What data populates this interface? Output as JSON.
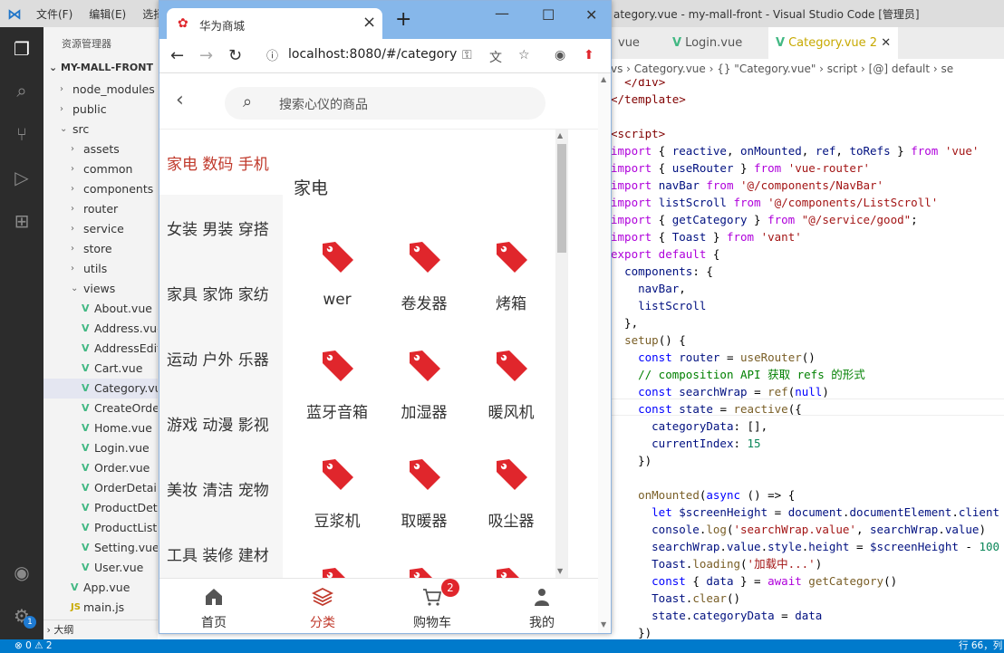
{
  "vscode": {
    "menu": [
      "文件(F)",
      "编辑(E)",
      "选择"
    ],
    "window_title": "ategory.vue - my-mall-front - Visual Studio Code [管理员]",
    "explorer_title": "资源管理器",
    "project_root": "MY-MALL-FRONT",
    "tree": [
      {
        "label": "node_modules",
        "type": "folder",
        "indent": 1
      },
      {
        "label": "public",
        "type": "folder",
        "indent": 1
      },
      {
        "label": "src",
        "type": "folder-open",
        "indent": 1
      },
      {
        "label": "assets",
        "type": "folder",
        "indent": 2
      },
      {
        "label": "common",
        "type": "folder",
        "indent": 2
      },
      {
        "label": "components",
        "type": "folder",
        "indent": 2
      },
      {
        "label": "router",
        "type": "folder",
        "indent": 2
      },
      {
        "label": "service",
        "type": "folder",
        "indent": 2
      },
      {
        "label": "store",
        "type": "folder",
        "indent": 2
      },
      {
        "label": "utils",
        "type": "folder",
        "indent": 2
      },
      {
        "label": "views",
        "type": "folder-open",
        "indent": 2
      },
      {
        "label": "About.vue",
        "type": "vue",
        "indent": 3
      },
      {
        "label": "Address.vue",
        "type": "vue",
        "indent": 3
      },
      {
        "label": "AddressEdit.vue",
        "type": "vue",
        "indent": 3
      },
      {
        "label": "Cart.vue",
        "type": "vue",
        "indent": 3
      },
      {
        "label": "Category.vue",
        "type": "vue",
        "indent": 3,
        "selected": true
      },
      {
        "label": "CreateOrder.vue",
        "type": "vue",
        "indent": 3
      },
      {
        "label": "Home.vue",
        "type": "vue",
        "indent": 3
      },
      {
        "label": "Login.vue",
        "type": "vue",
        "indent": 3
      },
      {
        "label": "Order.vue",
        "type": "vue",
        "indent": 3
      },
      {
        "label": "OrderDetail.vue",
        "type": "vue",
        "indent": 3
      },
      {
        "label": "ProductDetail.vue",
        "type": "vue",
        "indent": 3
      },
      {
        "label": "ProductList.vue",
        "type": "vue",
        "indent": 3
      },
      {
        "label": "Setting.vue",
        "type": "vue",
        "indent": 3
      },
      {
        "label": "User.vue",
        "type": "vue",
        "indent": 3
      },
      {
        "label": "App.vue",
        "type": "vue",
        "indent": 2
      },
      {
        "label": "main.js",
        "type": "js",
        "indent": 2
      }
    ],
    "outline": "大纲",
    "tabs": [
      {
        "label": "vue",
        "active": false
      },
      {
        "label": "Login.vue",
        "active": false
      },
      {
        "label": "Category.vue",
        "active": true,
        "badge": "2"
      }
    ],
    "breadcrumb": "vs › Category.vue › {} \"Category.vue\" › script › [@] default › se",
    "status_left": "⊗ 0 ⚠ 2",
    "status_right": "行 66，列",
    "account_badge": "1"
  },
  "browser": {
    "tab_title": "华为商城",
    "url": "localhost:8080/#/category"
  },
  "mall": {
    "search_placeholder": "搜索心仪的商品",
    "categories": [
      {
        "label": "家电 数码 手机",
        "active": true
      },
      {
        "label": "女装 男装 穿搭",
        "active": false
      },
      {
        "label": "家具 家饰 家纺",
        "active": false
      },
      {
        "label": "运动 户外 乐器",
        "active": false
      },
      {
        "label": "游戏 动漫 影视",
        "active": false
      },
      {
        "label": "美妆 清洁 宠物",
        "active": false
      },
      {
        "label": "工具 装修 建材",
        "active": false
      }
    ],
    "section_title": "家电",
    "products": [
      "wer",
      "卷发器",
      "烤箱",
      "蓝牙音箱",
      "加湿器",
      "暖风机",
      "豆浆机",
      "取暖器",
      "吸尘器"
    ],
    "tab_bar": [
      {
        "label": "首页",
        "icon": "home-icon",
        "active": false
      },
      {
        "label": "分类",
        "icon": "layers-icon",
        "active": true
      },
      {
        "label": "购物车",
        "icon": "cart-icon",
        "active": false,
        "badge": "2"
      },
      {
        "label": "我的",
        "icon": "user-icon",
        "active": false
      }
    ],
    "accent_color": "#c0392b",
    "tag_icon_color": "#e0262c"
  }
}
